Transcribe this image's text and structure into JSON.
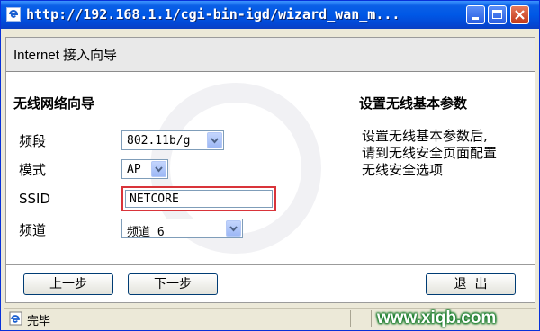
{
  "window": {
    "title": "http://192.168.1.1/cgi-bin-igd/wizard_wan_m..."
  },
  "page": {
    "title": "Internet 接入向导"
  },
  "form": {
    "section_title": "无线网络向导",
    "band": {
      "label": "频段",
      "value": "802.11b/g"
    },
    "mode": {
      "label": "模式",
      "value": "AP"
    },
    "ssid": {
      "label": "SSID",
      "value": "NETCORE"
    },
    "channel": {
      "label": "频道",
      "value": "频道 6"
    }
  },
  "info": {
    "title": "设置无线基本参数",
    "lines": [
      "设置无线基本参数后,",
      "请到无线安全页面配置",
      "无线安全选项"
    ]
  },
  "buttons": {
    "prev": "上一步",
    "next": "下一步",
    "exit": "退  出"
  },
  "status": {
    "text": "完毕"
  },
  "watermark": {
    "site": "www.xiqb.com"
  },
  "colors": {
    "titlebar": "#0058e6",
    "highlight_box": "#d9343a",
    "watermark_green": "#1a7d2c"
  }
}
